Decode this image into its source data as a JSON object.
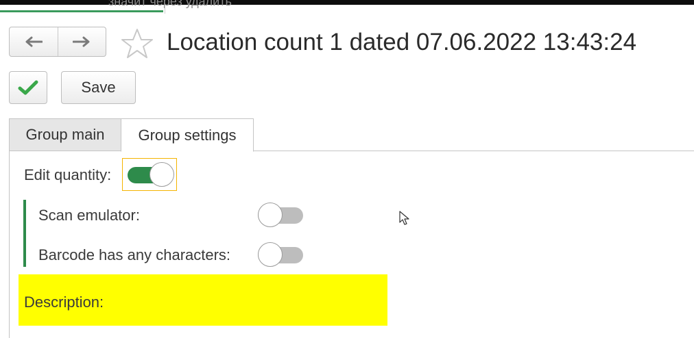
{
  "top_strip": {
    "tab_text": "значит через удалить"
  },
  "navigation": {
    "back_icon": "arrow-left-icon",
    "forward_icon": "arrow-right-icon",
    "favorite_icon": "star-icon"
  },
  "header": {
    "title": "Location count 1 dated 07.06.2022 13:43:24"
  },
  "toolbar": {
    "ok_icon": "checkmark-icon",
    "save_label": "Save"
  },
  "tabs": [
    {
      "label": "Group main",
      "active": false
    },
    {
      "label": "Group settings",
      "active": true
    }
  ],
  "settings": {
    "edit_quantity": {
      "label": "Edit quantity:",
      "value": true
    },
    "scan_emulator": {
      "label": "Scan emulator:",
      "value": false
    },
    "barcode_any_chars": {
      "label": "Barcode has any characters:",
      "value": false
    },
    "description": {
      "label": "Description:"
    }
  },
  "colors": {
    "accent_green": "#2e8b4b",
    "highlight_yellow": "#ffff00",
    "focus_orange": "#f5b400"
  }
}
